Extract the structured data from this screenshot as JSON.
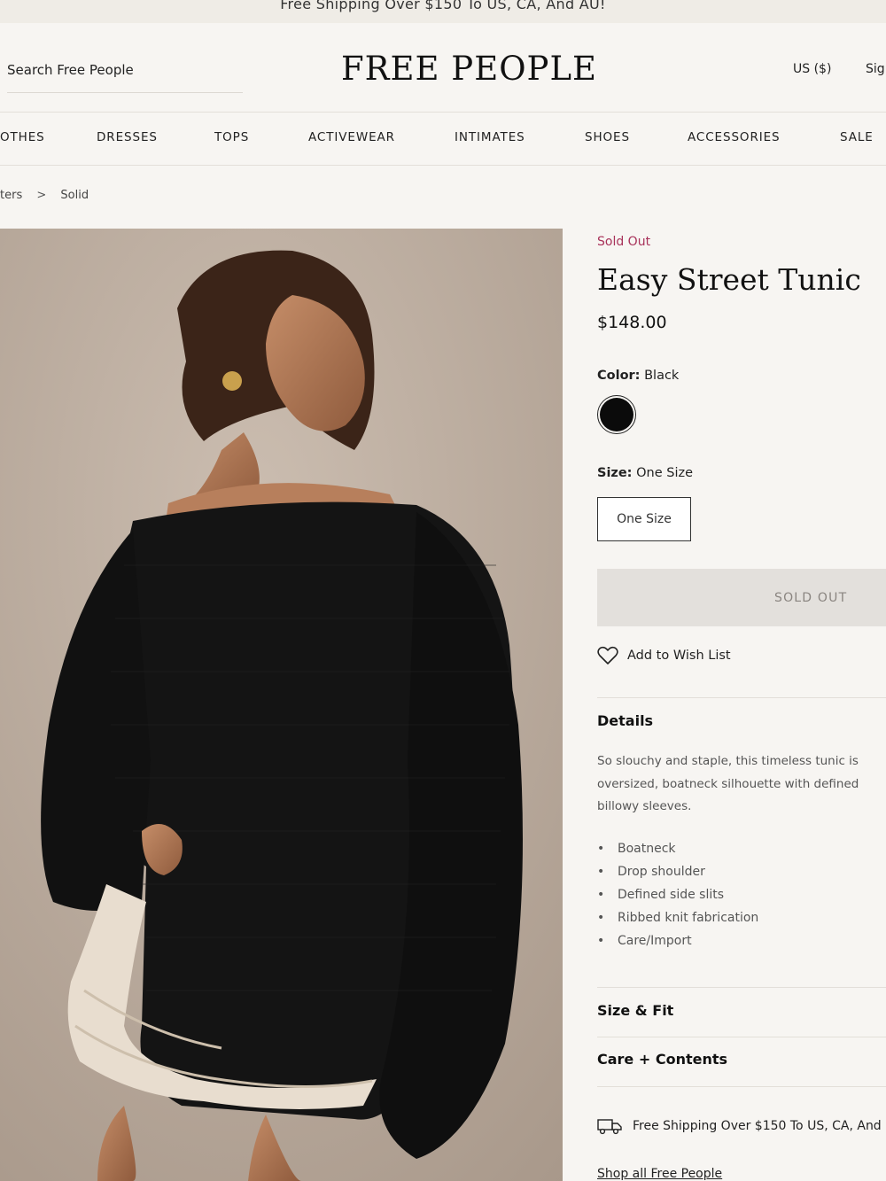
{
  "promo": {
    "text": "Free Shipping Over $150 To US, CA, And AU!"
  },
  "header": {
    "search_placeholder": "Search Free People",
    "logo": "FREE PEOPLE",
    "currency": "US ($)",
    "sign_in": "Sig"
  },
  "nav": {
    "items": [
      "OTHES",
      "DRESSES",
      "TOPS",
      "ACTIVEWEAR",
      "INTIMATES",
      "SHOES",
      "ACCESSORIES",
      "SALE"
    ]
  },
  "breadcrumb": {
    "items": [
      "ters",
      "Solid"
    ],
    "separator": ">"
  },
  "product": {
    "status": "Sold Out",
    "title": "Easy Street Tunic",
    "price": "$148.00",
    "color_label": "Color:",
    "color_value": "Black",
    "swatch_color": "#0b0b0b",
    "size_label": "Size:",
    "size_value": "One Size",
    "size_options": [
      "One Size"
    ],
    "sold_out_button": "SOLD OUT",
    "wishlist": "Add to Wish List"
  },
  "details": {
    "title": "Details",
    "description_lines": [
      "So slouchy and staple, this timeless tunic is",
      "oversized, boatneck silhouette with defined",
      "billowy sleeves."
    ],
    "bullets": [
      "Boatneck",
      "Drop shoulder",
      "Defined side slits",
      "Ribbed knit fabrication",
      "Care/Import"
    ]
  },
  "sections": {
    "size_fit": "Size & Fit",
    "care_contents": "Care + Contents"
  },
  "shipping": {
    "text": "Free Shipping Over $150 To US, CA, And"
  },
  "shop_all": "Shop all Free People",
  "colors": {
    "accent_sold": "#a8325a",
    "sold_button_bg": "#e3e0dc",
    "page_bg": "#f7f5f2"
  }
}
